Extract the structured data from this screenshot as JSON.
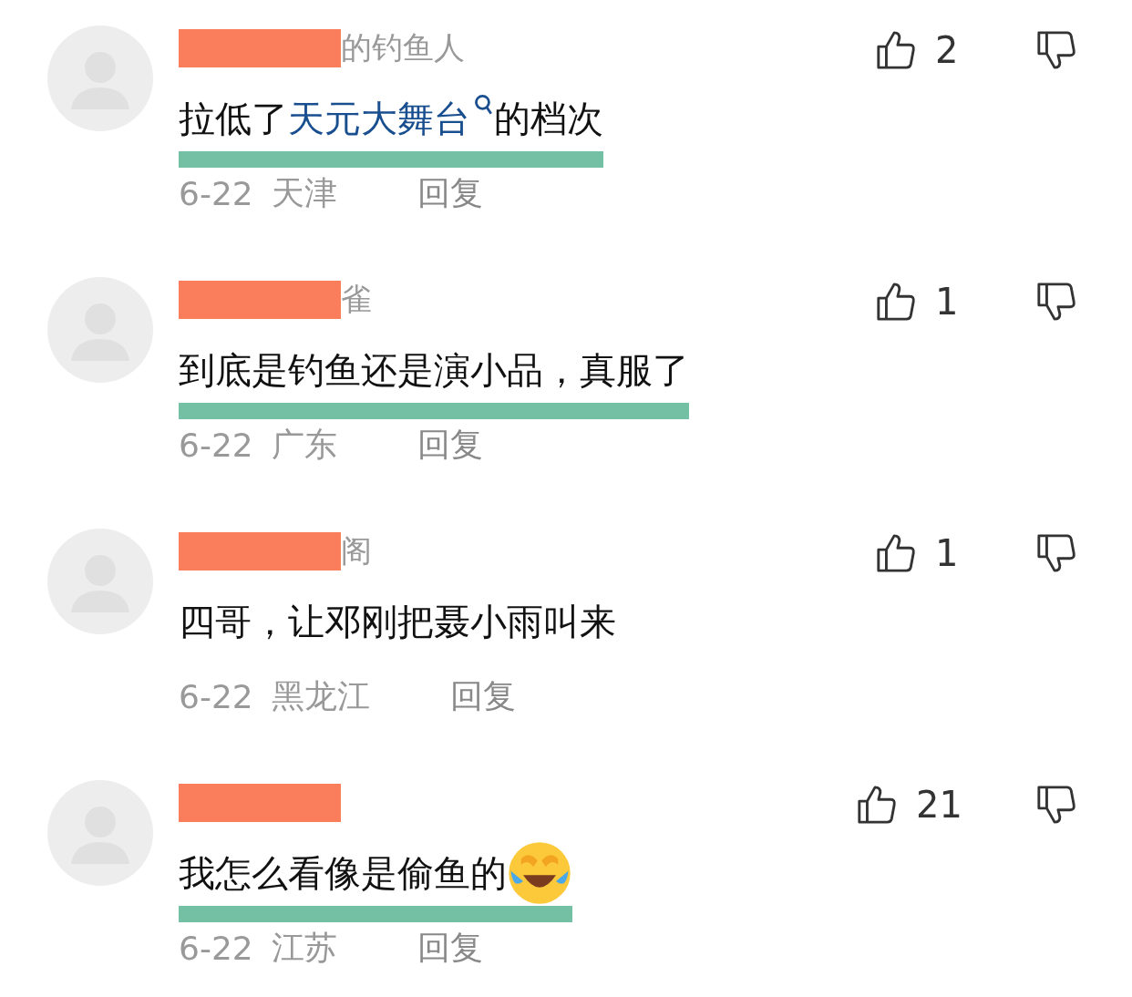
{
  "comments": [
    {
      "name": "的钓鱼人",
      "name_redacted": true,
      "content": [
        {
          "kind": "plain",
          "text": "拉低了"
        },
        {
          "kind": "link",
          "text": "天元大舞台"
        },
        {
          "kind": "plain",
          "text": " 的档次"
        }
      ],
      "highlighted": true,
      "date": "6-22",
      "location": "天津",
      "reply": "回复",
      "likes": "2"
    },
    {
      "name": "雀",
      "name_redacted": true,
      "content": [
        {
          "kind": "plain",
          "text": "到底是钓鱼还是演小品，真服了"
        }
      ],
      "highlighted": true,
      "date": "6-22",
      "location": "广东",
      "reply": "回复",
      "likes": "1"
    },
    {
      "name": "阁",
      "name_redacted": true,
      "content": [
        {
          "kind": "plain",
          "text": "四哥，让邓刚把聂小雨叫来"
        }
      ],
      "highlighted": false,
      "date": "6-22",
      "location": "黑龙江",
      "reply": "回复",
      "likes": "1"
    },
    {
      "name_redacted": true,
      "content": [
        {
          "kind": "plain",
          "text": "我怎么看像是偷鱼的"
        },
        {
          "kind": "emoji"
        }
      ],
      "highlighted": true,
      "date": "6-22",
      "location": "江苏",
      "reply": "回复",
      "likes": "21"
    }
  ]
}
